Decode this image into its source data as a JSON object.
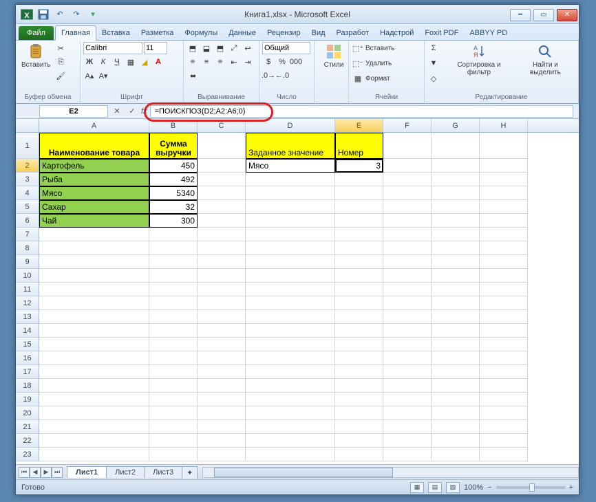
{
  "title": "Книга1.xlsx  -  Microsoft Excel",
  "ribbon_tabs": {
    "file": "Файл",
    "items": [
      "Главная",
      "Вставка",
      "Разметка",
      "Формулы",
      "Данные",
      "Рецензир",
      "Вид",
      "Разработ",
      "Надстрой",
      "Foxit PDF",
      "ABBYY PD"
    ],
    "active": 0
  },
  "ribbon_groups": {
    "clipboard": {
      "label": "Буфер обмена",
      "paste": "Вставить"
    },
    "font": {
      "label": "Шрифт",
      "name": "Calibri",
      "size": "11"
    },
    "alignment": {
      "label": "Выравнивание"
    },
    "number": {
      "label": "Число",
      "format": "Общий"
    },
    "styles": {
      "label": "Стили",
      "btn": "Стили"
    },
    "cells": {
      "label": "Ячейки",
      "insert": "Вставить",
      "delete": "Удалить",
      "format": "Формат"
    },
    "editing": {
      "label": "Редактирование",
      "sort": "Сортировка и фильтр",
      "find": "Найти и выделить"
    }
  },
  "name_box": "E2",
  "formula": "=ПОИСКПОЗ(D2;A2:A6;0)",
  "columns": [
    "A",
    "B",
    "C",
    "D",
    "E",
    "F",
    "G",
    "H"
  ],
  "headers": {
    "A1": "Наименование товара",
    "B1": "Сумма выручки",
    "D1": "Заданное значение",
    "E1": "Номер"
  },
  "data": {
    "A2": "Картофель",
    "B2": "450",
    "A3": "Рыба",
    "B3": "492",
    "A4": "Мясо",
    "B4": "5340",
    "A5": "Сахар",
    "B5": "32",
    "A6": "Чай",
    "B6": "300",
    "D2": "Мясо",
    "E2": "3"
  },
  "sheets": [
    "Лист1",
    "Лист2",
    "Лист3"
  ],
  "active_sheet": 0,
  "status": "Готово",
  "zoom": "100%"
}
